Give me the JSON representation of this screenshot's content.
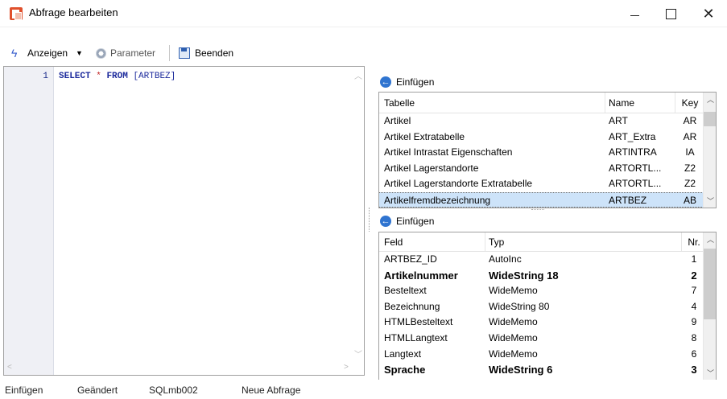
{
  "window": {
    "title": "Abfrage bearbeiten",
    "minimize_glyph": "",
    "maximize_glyph": "",
    "close_glyph": "✕"
  },
  "toolbar": {
    "anzeigen_label": "Anzeigen",
    "parameter_label": "Parameter",
    "beenden_label": "Beenden"
  },
  "editor": {
    "line_number": "1",
    "code_keyword1": "SELECT",
    "code_star": "*",
    "code_keyword2": "FROM",
    "code_table": "[ARTBEZ]"
  },
  "tables_panel": {
    "header_label": "Einfügen",
    "columns": [
      "Tabelle",
      "Name",
      "Key"
    ],
    "rows": [
      {
        "tabelle": "Artikel",
        "name": "ART",
        "key": "AR"
      },
      {
        "tabelle": "Artikel Extratabelle",
        "name": "ART_Extra",
        "key": "AR"
      },
      {
        "tabelle": "Artikel Intrastat Eigenschaften",
        "name": "ARTINTRA",
        "key": "IA"
      },
      {
        "tabelle": "Artikel Lagerstandorte",
        "name": "ARTORTL...",
        "key": "Z2"
      },
      {
        "tabelle": "Artikel Lagerstandorte Extratabelle",
        "name": "ARTORTL...",
        "key": "Z2"
      },
      {
        "tabelle": "Artikelfremdbezeichnung",
        "name": "ARTBEZ",
        "key": "AB"
      }
    ],
    "selected_index": 5
  },
  "fields_panel": {
    "header_label": "Einfügen",
    "columns": [
      "Feld",
      "Typ",
      "Nr."
    ],
    "rows": [
      {
        "feld": "ARTBEZ_ID",
        "typ": "AutoInc",
        "nr": "1",
        "bold": false
      },
      {
        "feld": "Artikelnummer",
        "typ": "WideString  18",
        "nr": "2",
        "bold": true
      },
      {
        "feld": "Besteltext",
        "typ": "WideMemo",
        "nr": "7",
        "bold": false
      },
      {
        "feld": "Bezeichnung",
        "typ": "WideString 80",
        "nr": "4",
        "bold": false
      },
      {
        "feld": "HTMLBesteltext",
        "typ": "WideMemo",
        "nr": "9",
        "bold": false
      },
      {
        "feld": "HTMLLangtext",
        "typ": "WideMemo",
        "nr": "8",
        "bold": false
      },
      {
        "feld": "Langtext",
        "typ": "WideMemo",
        "nr": "6",
        "bold": false
      },
      {
        "feld": "Sprache",
        "typ": "WideString  6",
        "nr": "3",
        "bold": true
      }
    ]
  },
  "statusbar": {
    "mode": "Einfügen",
    "changed": "Geändert",
    "connection": "SQLmb002",
    "query": "Neue Abfrage"
  }
}
